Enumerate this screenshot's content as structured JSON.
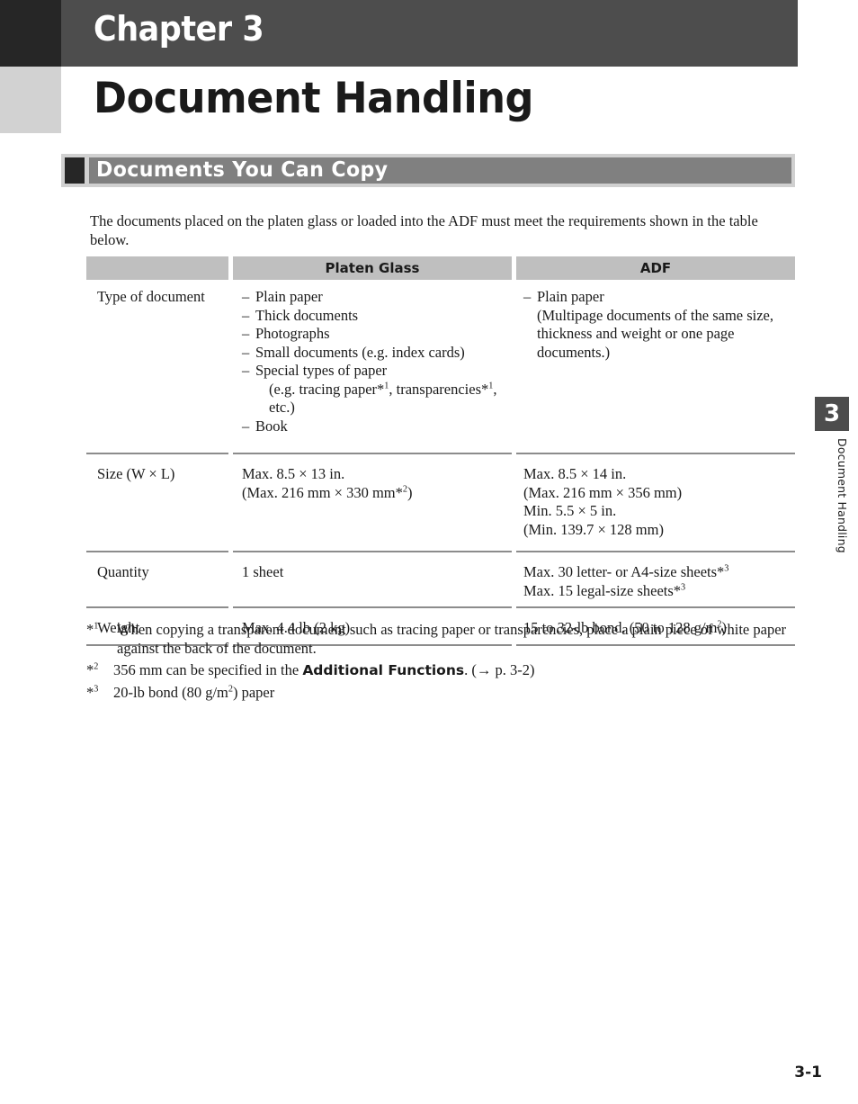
{
  "chapter": {
    "label": "Chapter 3",
    "title": "Document Handling"
  },
  "section": {
    "heading": "Documents You Can Copy"
  },
  "intro": "The documents placed on the platen glass or loaded into the ADF must meet the requirements shown in the table below.",
  "table": {
    "headers": [
      "",
      "Platen Glass",
      "ADF"
    ],
    "rows": [
      {
        "label": "Type of document",
        "platen_items": [
          "Plain paper",
          "Thick documents",
          "Photographs",
          "Small documents (e.g. index cards)",
          "Special types of paper"
        ],
        "platen_sub_1": "(e.g. tracing paper*1, transparencies*1,",
        "platen_sub_2": "etc.)",
        "platen_last": "Book",
        "adf_item": "Plain paper",
        "adf_sub_1": "(Multipage documents of the same size,",
        "adf_sub_2": "thickness and weight or one page",
        "adf_sub_3": "documents.)"
      },
      {
        "label": "Size (W × L)",
        "platen_lines": [
          "Max. 8.5 × 13 in.",
          "(Max. 216 mm × 330 mm*2)"
        ],
        "adf_lines": [
          "Max. 8.5 × 14 in.",
          "(Max. 216 mm × 356 mm)",
          "Min. 5.5 × 5 in.",
          "(Min. 139.7 × 128 mm)"
        ]
      },
      {
        "label": "Quantity",
        "platen_lines": [
          "1 sheet"
        ],
        "adf_lines": [
          "Max. 30 letter- or A4-size sheets*3",
          "Max. 15 legal-size sheets*3"
        ]
      },
      {
        "label": "Weight",
        "platen_lines": [
          "Max. 4.4 lb (2 kg)"
        ],
        "adf_lines": [
          "15 to 32-lb bond. (50 to 128 g/m2)"
        ]
      }
    ]
  },
  "footnotes": {
    "f1_mark": "*1",
    "f1_text": "When copying a transparent document such as tracing paper or transparencies, place a plain piece of white paper against the back of the document.",
    "f2_mark": "*2",
    "f2_before": "356 mm can be specified in the ",
    "f2_bold": "Additional Functions",
    "f2_after": ". (→ p. 3-2)",
    "f3_mark": "*3",
    "f3_text_before": "20-lb bond (80 g/m",
    "f3_sup": "2",
    "f3_text_after": ") paper"
  },
  "side_tab": {
    "number": "3",
    "text": "Document Handling"
  },
  "page_number": "3-1",
  "colors": {
    "chapter_bar": "#4d4d4d",
    "corner_dark": "#262626",
    "corner_light": "#d2d2d2",
    "section_outer": "#d0d0d0",
    "section_bar": "#808080",
    "table_header": "#bfbfbf",
    "rule": "#8c8c8c"
  }
}
